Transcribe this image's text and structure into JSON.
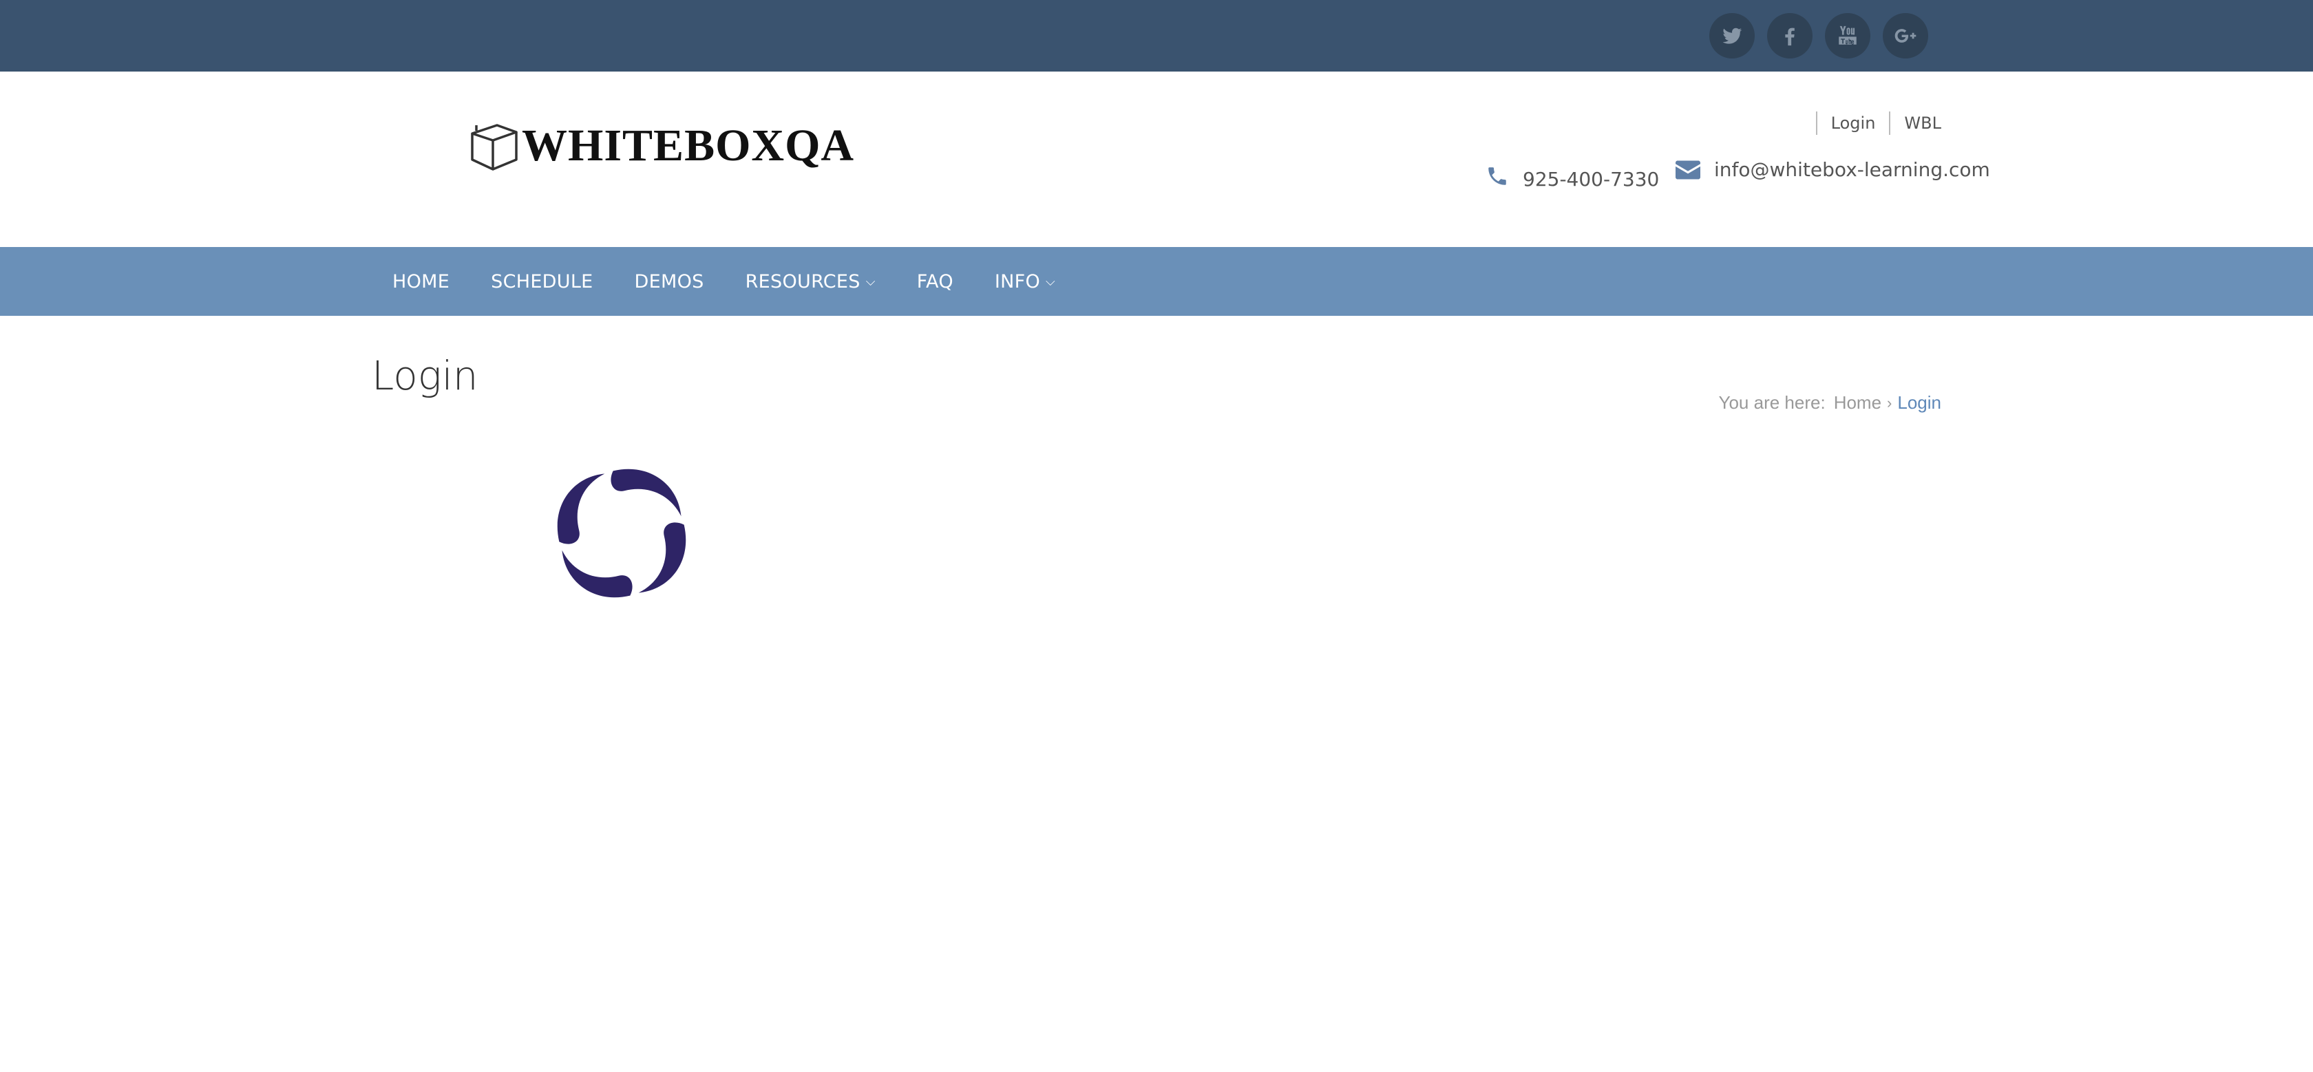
{
  "social": {
    "items": [
      {
        "name": "twitter",
        "icon": "twitter-icon"
      },
      {
        "name": "facebook",
        "icon": "facebook-icon"
      },
      {
        "name": "youtube",
        "icon": "youtube-icon"
      },
      {
        "name": "google-plus",
        "icon": "google-plus-icon"
      }
    ]
  },
  "header": {
    "logo_text": "WHITEBOXQA",
    "logo_icon": "box-icon",
    "top_links": {
      "login": "Login",
      "wbl": "WBL"
    },
    "phone": "925-400-7330",
    "email": "info@whitebox-learning.com"
  },
  "nav": {
    "items": [
      {
        "label": "HOME"
      },
      {
        "label": "SCHEDULE"
      },
      {
        "label": "DEMOS"
      },
      {
        "label": "RESOURCES",
        "caret": "⌵"
      },
      {
        "label": "FAQ"
      },
      {
        "label": "INFO",
        "caret": "⌵"
      }
    ]
  },
  "main": {
    "title": "Login",
    "breadcrumb": {
      "label": "You are here:",
      "home": "Home",
      "separator": "›",
      "current": "Login"
    }
  },
  "colors": {
    "topbar": "#3a536f",
    "nav": "#6a90b8",
    "accent": "#5f88b8",
    "spinner": "#2e2466"
  }
}
